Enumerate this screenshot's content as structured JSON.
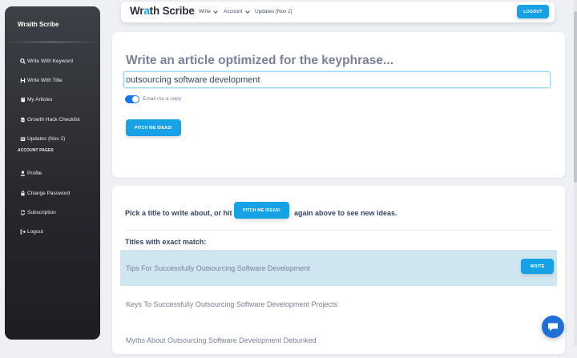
{
  "sidebar": {
    "brand": "Wraith Scribe",
    "items": [
      {
        "label": "Write With Keyword",
        "icon": "search-icon"
      },
      {
        "label": "Write With Title",
        "icon": "heading-icon"
      },
      {
        "label": "My Articles",
        "icon": "book-icon"
      },
      {
        "label": "Growth Hack Checklist",
        "icon": "document-icon"
      },
      {
        "label": "Updates (Nov 2)",
        "icon": "newspaper-icon"
      }
    ],
    "account_heading": "ACCOUNT PAGES",
    "account_items": [
      {
        "label": "Profile",
        "icon": "user-icon"
      },
      {
        "label": "Change Password",
        "icon": "lock-icon"
      },
      {
        "label": "Subscription",
        "icon": "refresh-icon"
      },
      {
        "label": "Logout",
        "icon": "logout-icon"
      }
    ]
  },
  "topbar": {
    "logo_pre": "Wr",
    "logo_accent": "a",
    "logo_post": "th Scribe",
    "nav": [
      {
        "label": "Write"
      },
      {
        "label": "Account"
      },
      {
        "label": "Updates [Nov 2]"
      }
    ],
    "logout_label": "LOGOUT"
  },
  "form": {
    "heading": "Write an article optimized for the keyphrase...",
    "keyphrase_value": "outsourcing software development",
    "email_copy_label": "Email me a copy",
    "email_copy_on": true,
    "pitch_label": "PITCH ME IDEAS!"
  },
  "titles": {
    "pick_prefix": "Pick a title to write about, or hit",
    "pick_button": "PITCH ME IDEAS!",
    "pick_suffix": "again above to see new ideas.",
    "exact_heading": "Titles with exact match:",
    "write_label": "WRITE",
    "rows": [
      {
        "title": "Tips For Successfully Outsourcing Software Development"
      },
      {
        "title": "Keys To Successfully Outsourcing Software Development Projects"
      },
      {
        "title": "Myths About Outsourcing Software Development Debunked"
      }
    ]
  },
  "colors": {
    "accent": "#17a2e6",
    "highlight_row": "#cfe6f0",
    "toggle_on": "#1a73e8",
    "chat": "#1f6fd6"
  }
}
